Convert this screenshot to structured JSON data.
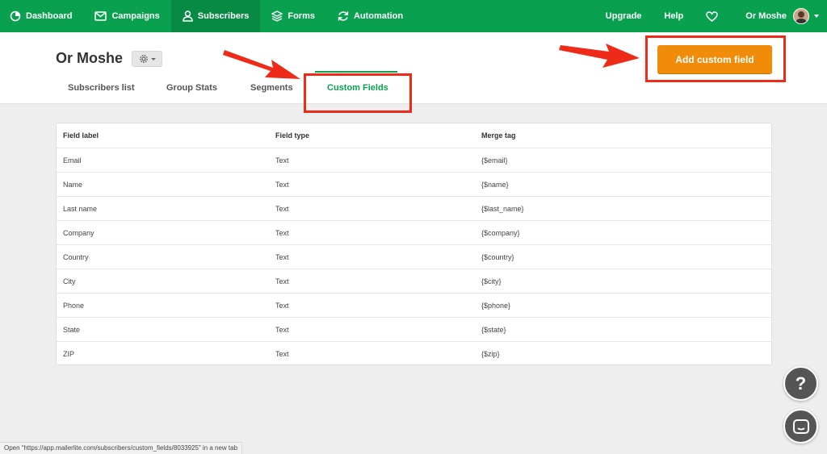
{
  "nav": {
    "items": [
      {
        "label": "Dashboard",
        "icon": "dashboard-icon"
      },
      {
        "label": "Campaigns",
        "icon": "envelope-icon"
      },
      {
        "label": "Subscribers",
        "icon": "user-icon"
      },
      {
        "label": "Forms",
        "icon": "layers-icon"
      },
      {
        "label": "Automation",
        "icon": "refresh-icon"
      }
    ],
    "upgrade": "Upgrade",
    "help": "Help",
    "user_name": "Or Moshe"
  },
  "header": {
    "account_name": "Or Moshe",
    "tabs": [
      "Subscribers list",
      "Group Stats",
      "Segments",
      "Custom Fields"
    ],
    "active_tab": "Custom Fields",
    "add_button": "Add custom field"
  },
  "table": {
    "columns": [
      "Field label",
      "Field type",
      "Merge tag"
    ],
    "rows": [
      [
        "Email",
        "Text",
        "{$email}"
      ],
      [
        "Name",
        "Text",
        "{$name}"
      ],
      [
        "Last name",
        "Text",
        "{$last_name}"
      ],
      [
        "Company",
        "Text",
        "{$company}"
      ],
      [
        "Country",
        "Text",
        "{$country}"
      ],
      [
        "City",
        "Text",
        "{$city}"
      ],
      [
        "Phone",
        "Text",
        "{$phone}"
      ],
      [
        "State",
        "Text",
        "{$state}"
      ],
      [
        "ZIP",
        "Text",
        "{$zip}"
      ]
    ]
  },
  "fab": {
    "help_glyph": "?"
  },
  "status_bar": "Open “https://app.mailerlite.com/subscribers/custom_fields/8033925” in a new tab",
  "colors": {
    "brand_green": "#09a14f",
    "accent_orange": "#f08c0a",
    "highlight_red": "#ee2a18"
  }
}
